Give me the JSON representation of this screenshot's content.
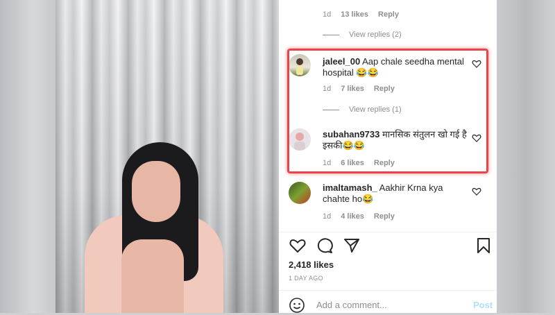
{
  "comments": [
    {
      "username": "",
      "text": "",
      "time": "1d",
      "likes": "13 likes",
      "reply": "Reply",
      "view_replies": "View replies (2)"
    },
    {
      "username": "jaleel_00",
      "text": "Aap chale seedha mental hospital 😂😂",
      "time": "1d",
      "likes": "7 likes",
      "reply": "Reply",
      "view_replies": "View replies (1)"
    },
    {
      "username": "subahan9733",
      "text": "मानसिक संतुलन खो गई है इसकी😂😂",
      "time": "1d",
      "likes": "6 likes",
      "reply": "Reply"
    },
    {
      "username": "imaltamash_",
      "text": "Aakhir Krna kya chahte ho😂",
      "time": "1d",
      "likes": "4 likes",
      "reply": "Reply"
    }
  ],
  "post": {
    "likes": "2,418 likes",
    "date": "1 DAY AGO"
  },
  "comment_box": {
    "placeholder": "Add a comment...",
    "post_label": "Post"
  },
  "colors": {
    "highlight": "#e8444b",
    "post_disabled": "#b2dffc",
    "muted_text": "#8e8e8e"
  },
  "icons": [
    "heart-icon",
    "comment-icon",
    "share-icon",
    "bookmark-icon",
    "emoji-icon",
    "mute-icon"
  ]
}
